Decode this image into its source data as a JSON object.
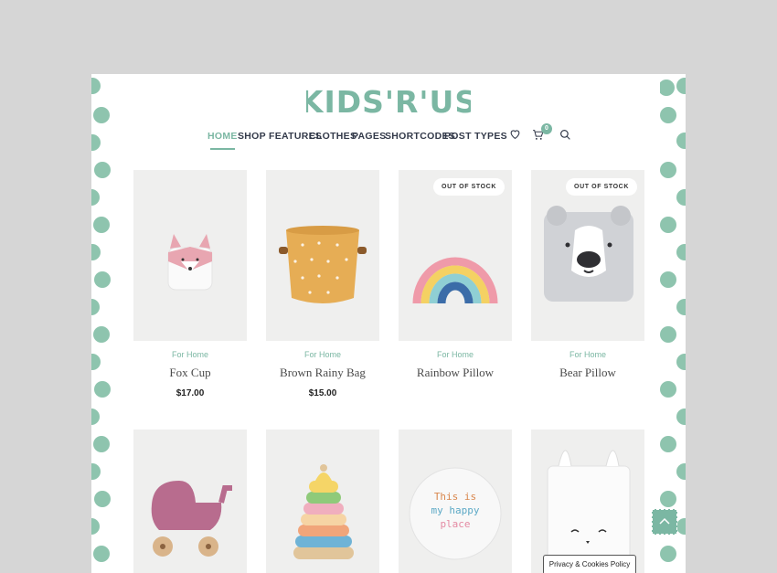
{
  "brand": {
    "logo_text": "KIDS'R'US",
    "accent_color": "#7bb7a3",
    "dot_color": "#8ec4ae"
  },
  "nav": {
    "items": [
      "HOME",
      "SHOP FEATURES",
      "CLOTHES",
      "PAGES",
      "SHORTCODES",
      "POST TYPES"
    ],
    "active": "HOME",
    "icons": [
      "heart-icon",
      "cart-icon",
      "search-icon"
    ],
    "cart_count": "0"
  },
  "products": [
    {
      "category": "For Home",
      "name": "Fox Cup",
      "price": "$17.00",
      "badge": ""
    },
    {
      "category": "For Home",
      "name": "Brown Rainy Bag",
      "price": "$15.00",
      "badge": ""
    },
    {
      "category": "For Home",
      "name": "Rainbow Pillow",
      "price": "",
      "badge": "OUT OF STOCK"
    },
    {
      "category": "For Home",
      "name": "Bear Pillow",
      "price": "",
      "badge": "OUT OF STOCK"
    }
  ],
  "products_row2": [
    {
      "image": "pink-stroller"
    },
    {
      "image": "ring-stacker"
    },
    {
      "image": "happy-place-print",
      "image_text": [
        "This is",
        "my happy",
        "place"
      ]
    },
    {
      "image": "bunny-bag"
    }
  ],
  "cookie_button": "Privacy & Cookies Policy"
}
